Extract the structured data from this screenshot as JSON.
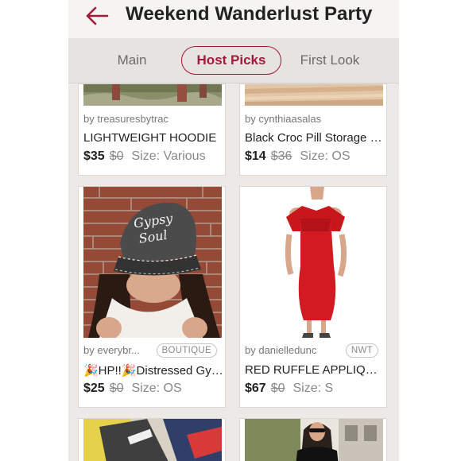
{
  "header": {
    "title": "Weekend Wanderlust Party",
    "back_icon": "arrow-left-icon",
    "accent": "#a3193a"
  },
  "tabs": [
    {
      "label": "Main",
      "active": false
    },
    {
      "label": "Host Picks",
      "active": true
    },
    {
      "label": "First Look",
      "active": false
    }
  ],
  "listings": [
    {
      "seller": "by treasuresbytrac",
      "badge": "",
      "title": "LIGHTWEIGHT HOODIE",
      "price": "$35",
      "original_price": "$0",
      "size": "Size: Various"
    },
    {
      "seller": "by cynthiaasalas",
      "badge": "",
      "title": "Black Croc Pill Storage Case",
      "price": "$14",
      "original_price": "$36",
      "size": "Size: OS"
    },
    {
      "seller": "by everybr...",
      "badge": "BOUTIQUE",
      "title": "🎉HP!!🎉Distressed Gypsy Soul Hat",
      "price": "$25",
      "original_price": "$0",
      "size": "Size: OS"
    },
    {
      "seller": "by danielledunc",
      "badge": "NWT",
      "title": "RED RUFFLE APPLIQUE DRESS",
      "price": "$67",
      "original_price": "$0",
      "size": "Size: S"
    }
  ],
  "hat_embroidery": "Gypsy Soul"
}
